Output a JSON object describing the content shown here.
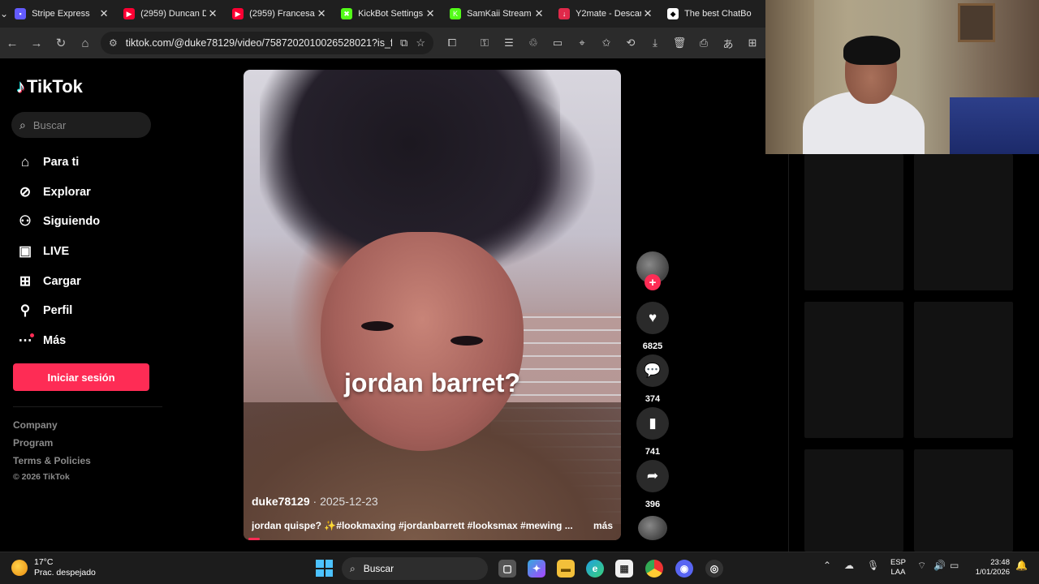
{
  "browser": {
    "tabs": [
      {
        "label": "Stripe Express",
        "color": "#635bff",
        "glyph": "▪"
      },
      {
        "label": "(2959) Duncan D",
        "color": "#ff0033",
        "glyph": "▶"
      },
      {
        "label": "(2959) Francesa",
        "color": "#ff0033",
        "glyph": "▶"
      },
      {
        "label": "KickBot Settings",
        "color": "#53fc18",
        "glyph": "✖"
      },
      {
        "label": "SamKaii Stream",
        "color": "#53fc18",
        "glyph": "K"
      },
      {
        "label": "Y2mate - Descar",
        "color": "#e0294a",
        "glyph": "↓"
      },
      {
        "label": "The best ChatBo",
        "color": "#ffffff",
        "glyph": "◆"
      }
    ],
    "url": "tiktok.com/@duke78129/video/7587202010026528021?is_f..."
  },
  "tiktok": {
    "logo": "TikTok",
    "search_placeholder": "Buscar",
    "nav": [
      {
        "label": "Para ti",
        "icon": "home-icon"
      },
      {
        "label": "Explorar",
        "icon": "compass-icon"
      },
      {
        "label": "Siguiendo",
        "icon": "following-icon"
      },
      {
        "label": "LIVE",
        "icon": "live-icon"
      },
      {
        "label": "Cargar",
        "icon": "upload-icon"
      },
      {
        "label": "Perfil",
        "icon": "profile-icon"
      },
      {
        "label": "Más",
        "icon": "more-icon"
      }
    ],
    "login_label": "Iniciar sesión",
    "footer_links": [
      "Company",
      "Program",
      "Terms & Policies"
    ],
    "copyright": "© 2026 TikTok"
  },
  "video": {
    "overlay_text": "jordan barret?",
    "author": "duke78129",
    "date": "2025-12-23",
    "caption": "jordan quispe? ✨#lookmaxing #jordanbarrett #looksmax #mewing ...",
    "more_label": "más",
    "progress_fraction": 0.03
  },
  "actions": {
    "likes": "6825",
    "comments": "374",
    "saves": "741",
    "shares": "396"
  },
  "taskbar": {
    "temperature": "17°C",
    "weather": "Prac. despejado",
    "search_label": "Buscar",
    "lang_line1": "ESP",
    "lang_line2": "LAA",
    "time": "23:48",
    "date": "1/01/2026"
  }
}
